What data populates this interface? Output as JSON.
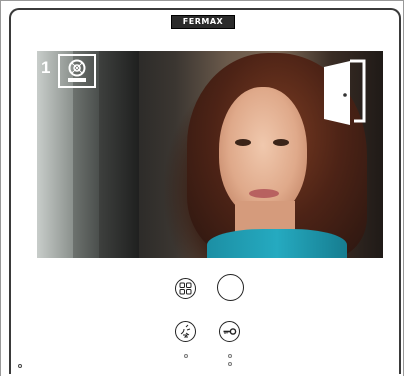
{
  "brand": {
    "logo_text": "FERMAX"
  },
  "screen": {
    "camera_number": "1",
    "camera_icon": "camera-monitor-icon",
    "door_icon": "door-open-icon"
  },
  "controls": {
    "menu_icon": "grid-menu-icon",
    "main_icon": "circle-button-icon",
    "audio_icon": "hands-free-audio-icon",
    "key_icon": "key-icon"
  },
  "colors": {
    "frame": "#3a3a3a",
    "overlay": "#ffffff"
  }
}
